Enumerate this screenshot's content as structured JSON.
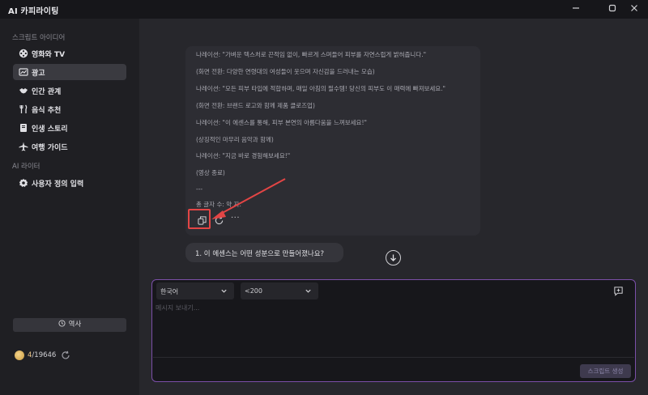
{
  "window": {
    "title": "AI 카피라이팅"
  },
  "sidebar": {
    "section_script_ideas": "스크립트 아이디어",
    "items": [
      {
        "label": "영화와 TV",
        "icon": "film-reel-icon"
      },
      {
        "label": "광고",
        "icon": "chart-icon",
        "active": true
      },
      {
        "label": "인간 관계",
        "icon": "handshake-icon"
      },
      {
        "label": "음식 추천",
        "icon": "fork-knife-icon"
      },
      {
        "label": "인생 스토리",
        "icon": "book-icon"
      },
      {
        "label": "여행 가이드",
        "icon": "airplane-icon"
      }
    ],
    "section_ai_writer": "AI 라이터",
    "custom_item": {
      "label": "사용자 정의 입력",
      "icon": "gear-icon"
    },
    "history_label": "역사",
    "credits_used": "4",
    "credits_total": "/19646"
  },
  "chat": {
    "lines": [
      "나레이션: \"가벼운 텍스처로 끈적임 없이, 빠르게 스며들어 피부를 자연스럽게 밝혀줍니다.\"",
      "(화면 전환: 다양한 연령대의 여성들이 웃으며 자신감을 드러내는 모습)",
      "나레이션: \"모든 피부 타입에 적합하며, 매일 아침의 필수템! 당신의 피부도 이 매력에 빠져보세요.\"",
      "(화면 전환: 브랜드 로고와 함께 제품 클로즈업)",
      "나레이션: \"이 에센스를 통해, 피부 본연의 아름다움을 느껴보세요!\"",
      "(상징적인 마무리 음악과 함께)",
      "나레이션: \"지금 바로 경험해보세요!\"",
      "(영상 종료)",
      "---",
      "총 글자 수: 약 자."
    ],
    "suggestion": "1. 이 에센스는 어떤 성분으로 만들어졌나요?"
  },
  "composer": {
    "language": "한국어",
    "length": "<200",
    "placeholder": "메시지 보내기...",
    "generate_label": "스크립트 생성"
  },
  "colors": {
    "accent_border": "#7b4fa8",
    "highlight_red": "#e34545",
    "active_nav": "#3a3a40"
  }
}
